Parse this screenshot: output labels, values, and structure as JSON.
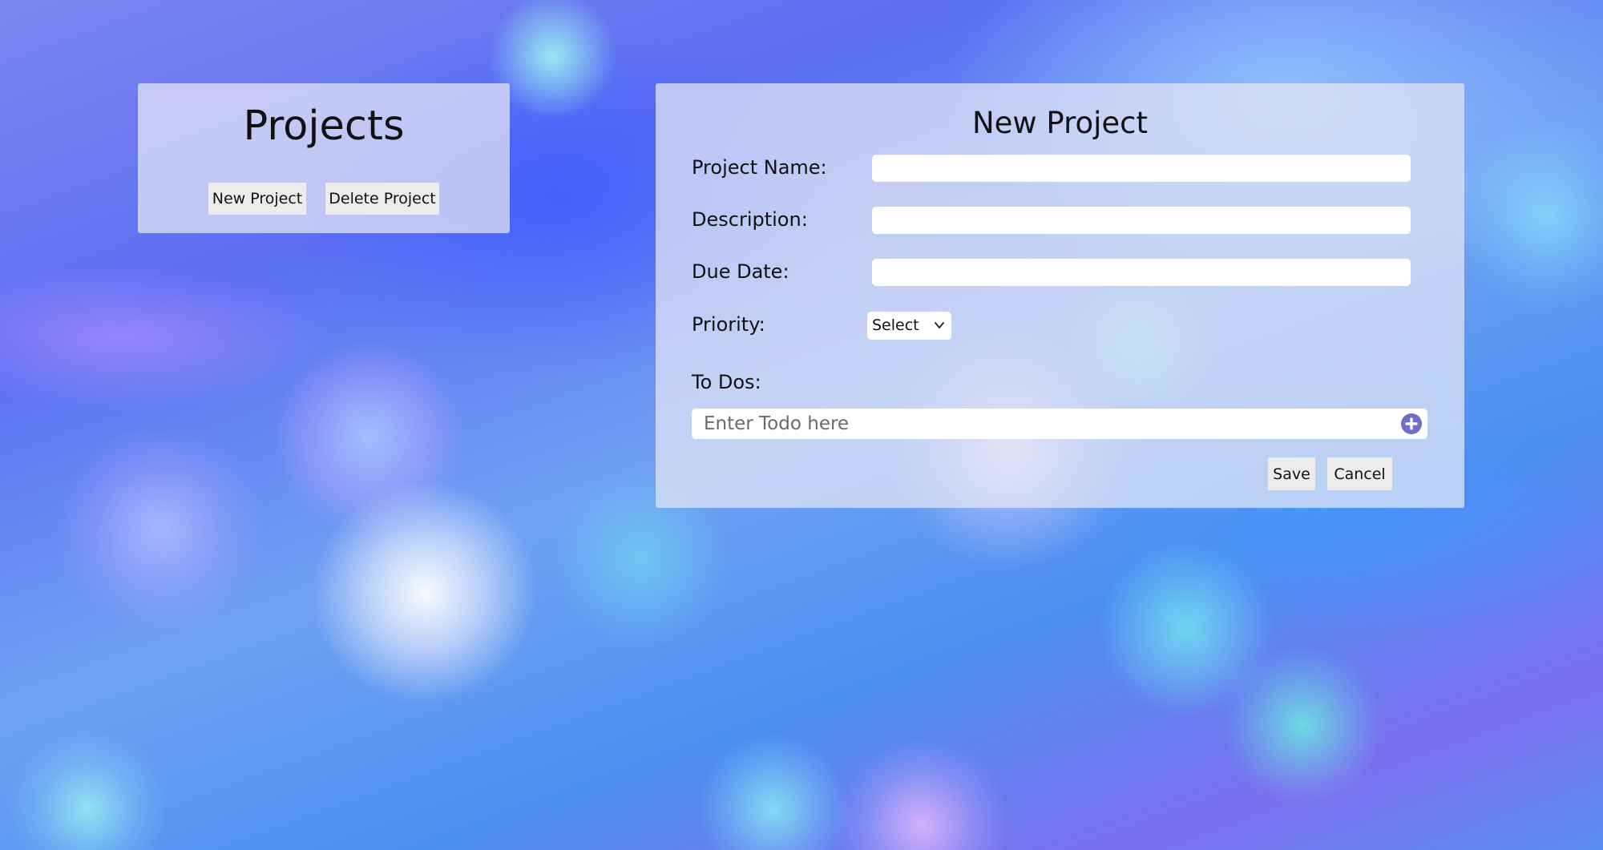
{
  "projects_panel": {
    "title": "Projects",
    "new_project_label": "New Project",
    "delete_project_label": "Delete Project"
  },
  "new_project_form": {
    "title": "New Project",
    "fields": {
      "project_name": {
        "label": "Project Name:",
        "value": ""
      },
      "description": {
        "label": "Description:",
        "value": ""
      },
      "due_date": {
        "label": "Due Date:",
        "value": ""
      },
      "priority": {
        "label": "Priority:",
        "selected": "Select"
      }
    },
    "todos": {
      "label": "To Dos:",
      "placeholder": "Enter Todo here",
      "add_icon": "plus-circle-icon"
    },
    "save_label": "Save",
    "cancel_label": "Cancel"
  },
  "colors": {
    "panel_bg": "#E2E6F6",
    "accent": "#6E6FC8",
    "button_bg": "#ECECEC"
  }
}
